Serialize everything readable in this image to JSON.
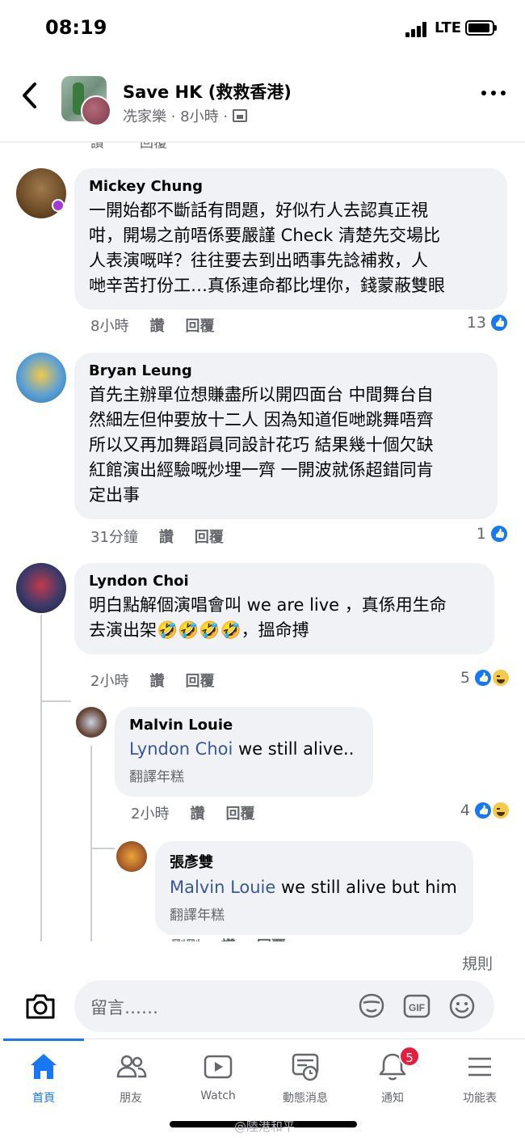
{
  "status_bar": {
    "time": "08:19",
    "network": "LTE"
  },
  "header": {
    "title": "Save HK (救救香港)",
    "subtitle": "冼家樂 · 8小時 ·"
  },
  "labels": {
    "like": "讚",
    "reply": "回覆",
    "translate": "翻譯年糕"
  },
  "comments": [
    {
      "name": "Mickey Chung",
      "lines": [
        "一開始都不斷話有問題，好似冇人去認真正視",
        "咁，開場之前唔係要嚴謹 Check 清楚先交場比",
        "人表演嘅咩？往往要去到出晒事先諗補救，人",
        "哋辛苦打份工…真係連命都比埋你，錢蒙蔽雙眼"
      ],
      "time": "8小時",
      "reactions": "13"
    },
    {
      "name": "Bryan Leung",
      "lines": [
        "首先主辦單位想賺盡所以開四面台 中間舞台自",
        "然細左但仲要放十二人 因為知道佢哋跳舞唔齊",
        "所以又再加舞蹈員同設計花巧 結果幾十個欠缺",
        "紅館演出經驗嘅炒埋一齊 一開波就係超錯同肯",
        "定出事"
      ],
      "time": "31分鐘",
      "reactions": "1"
    },
    {
      "name": "Lyndon Choi",
      "lines": [
        "明白點解個演唱會叫 we are live ，真係用生命",
        "去演出架🤣🤣🤣🤣，搵命搏"
      ],
      "time": "2小時",
      "reactions": "5"
    },
    {
      "name": "Malvin Louie",
      "mention": "Lyndon Choi",
      "text": " we still alive..",
      "time": "2小時",
      "reactions": "4"
    },
    {
      "name": "張彥雙",
      "mention": "Malvin Louie",
      "text": " we still alive but him",
      "time": "剛剛"
    }
  ],
  "footer": {
    "rules": "規則",
    "placeholder": "留言……",
    "tabs": [
      {
        "label": "首頁",
        "icon": "home-icon"
      },
      {
        "label": "朋友",
        "icon": "friends-icon"
      },
      {
        "label": "Watch",
        "icon": "watch-icon"
      },
      {
        "label": "動態消息",
        "icon": "feed-icon"
      },
      {
        "label": "通知",
        "icon": "bell-icon",
        "badge": "5"
      },
      {
        "label": "功能表",
        "icon": "menu-icon"
      }
    ],
    "watermark": "@陸港和平"
  },
  "colors": {
    "accent": "#1877f2",
    "bubble": "#f0f2f5",
    "secondary_text": "#65676b",
    "badge": "#e41e3f"
  }
}
